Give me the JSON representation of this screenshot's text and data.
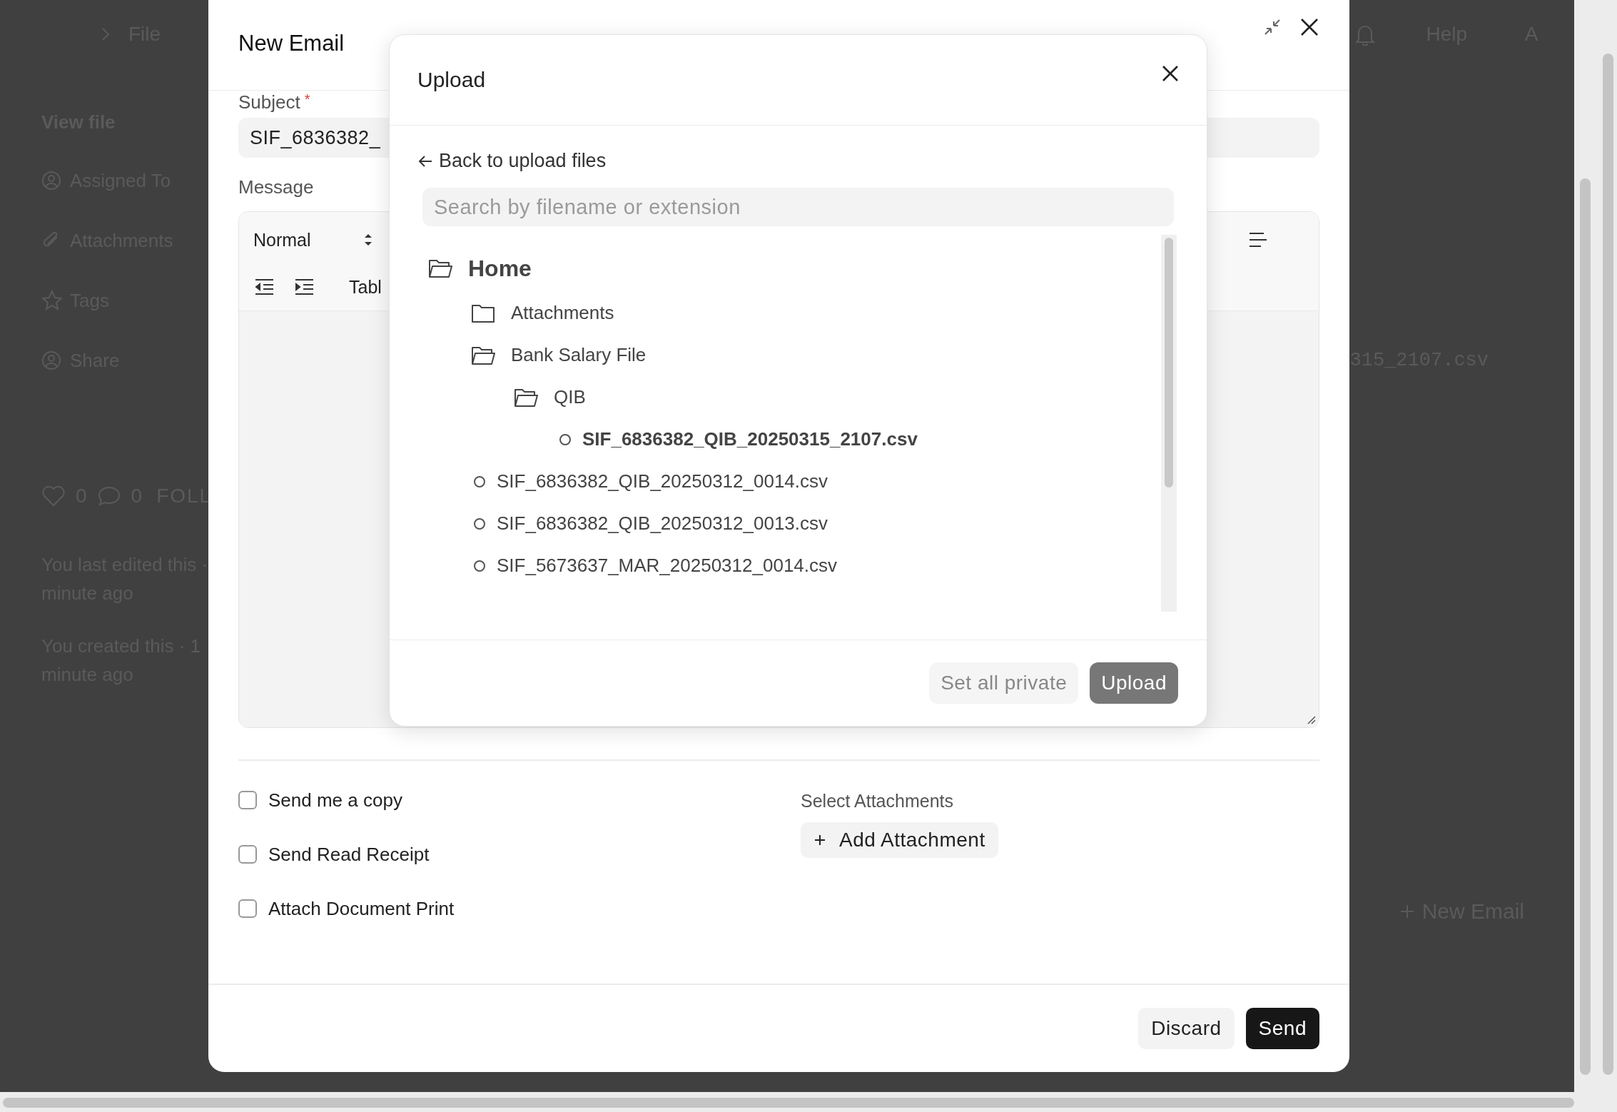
{
  "background": {
    "breadcrumb": [
      "File"
    ],
    "sidebar_title": "View file",
    "sidebar_items": [
      {
        "kind": "assign",
        "label": "Assigned To"
      },
      {
        "kind": "attach",
        "label": "Attachments"
      },
      {
        "kind": "tag",
        "label": "Tags"
      },
      {
        "kind": "share",
        "label": "Share"
      }
    ],
    "likes": "0",
    "comments": "0",
    "follow": "FOLL",
    "activity": [
      "You last edited this ·",
      "minute ago",
      "You created this · 1",
      "minute ago"
    ],
    "help": "Help",
    "avatar": "A",
    "file_name": "315_2107.csv",
    "new_email": "New Email"
  },
  "email": {
    "title": "New Email",
    "subject_label": "Subject",
    "required_mark": "*",
    "subject": "SIF_6836382_",
    "message_label": "Message",
    "toolbar": {
      "style_select": "Normal",
      "table_select": "Tabl",
      "buttons": [
        {
          "kind": "align"
        }
      ]
    },
    "options": [
      {
        "label": "Send me a copy",
        "checked": false
      },
      {
        "label": "Send Read Receipt",
        "checked": false
      },
      {
        "label": "Attach Document Print",
        "checked": false
      }
    ],
    "attachments_label": "Select Attachments",
    "add_attachment": "Add Attachment",
    "discard": "Discard",
    "send": "Send"
  },
  "upload": {
    "title": "Upload",
    "back": "Back to upload files",
    "search_placeholder": "Search by filename or extension",
    "tree": {
      "kind": "folder",
      "label": "Home",
      "expanded": true,
      "children": [
        {
          "kind": "folder",
          "label": "Attachments",
          "expanded": false
        },
        {
          "kind": "folder",
          "label": "Bank Salary File",
          "expanded": true,
          "children": [
            {
              "kind": "folder",
              "label": "QIB",
              "expanded": true,
              "children": [
                {
                  "kind": "file",
                  "label": "SIF_6836382_QIB_20250315_2107.csv",
                  "selected": true
                }
              ]
            }
          ]
        },
        {
          "kind": "file",
          "label": "SIF_6836382_QIB_20250312_0014.csv",
          "selected": false
        },
        {
          "kind": "file",
          "label": "SIF_6836382_QIB_20250312_0013.csv",
          "selected": false
        },
        {
          "kind": "file",
          "label": "SIF_5673637_MAR_20250312_0014.csv",
          "selected": false
        }
      ]
    },
    "set_private": "Set all private",
    "upload_button": {
      "label": "Upload",
      "disabled": true
    }
  }
}
